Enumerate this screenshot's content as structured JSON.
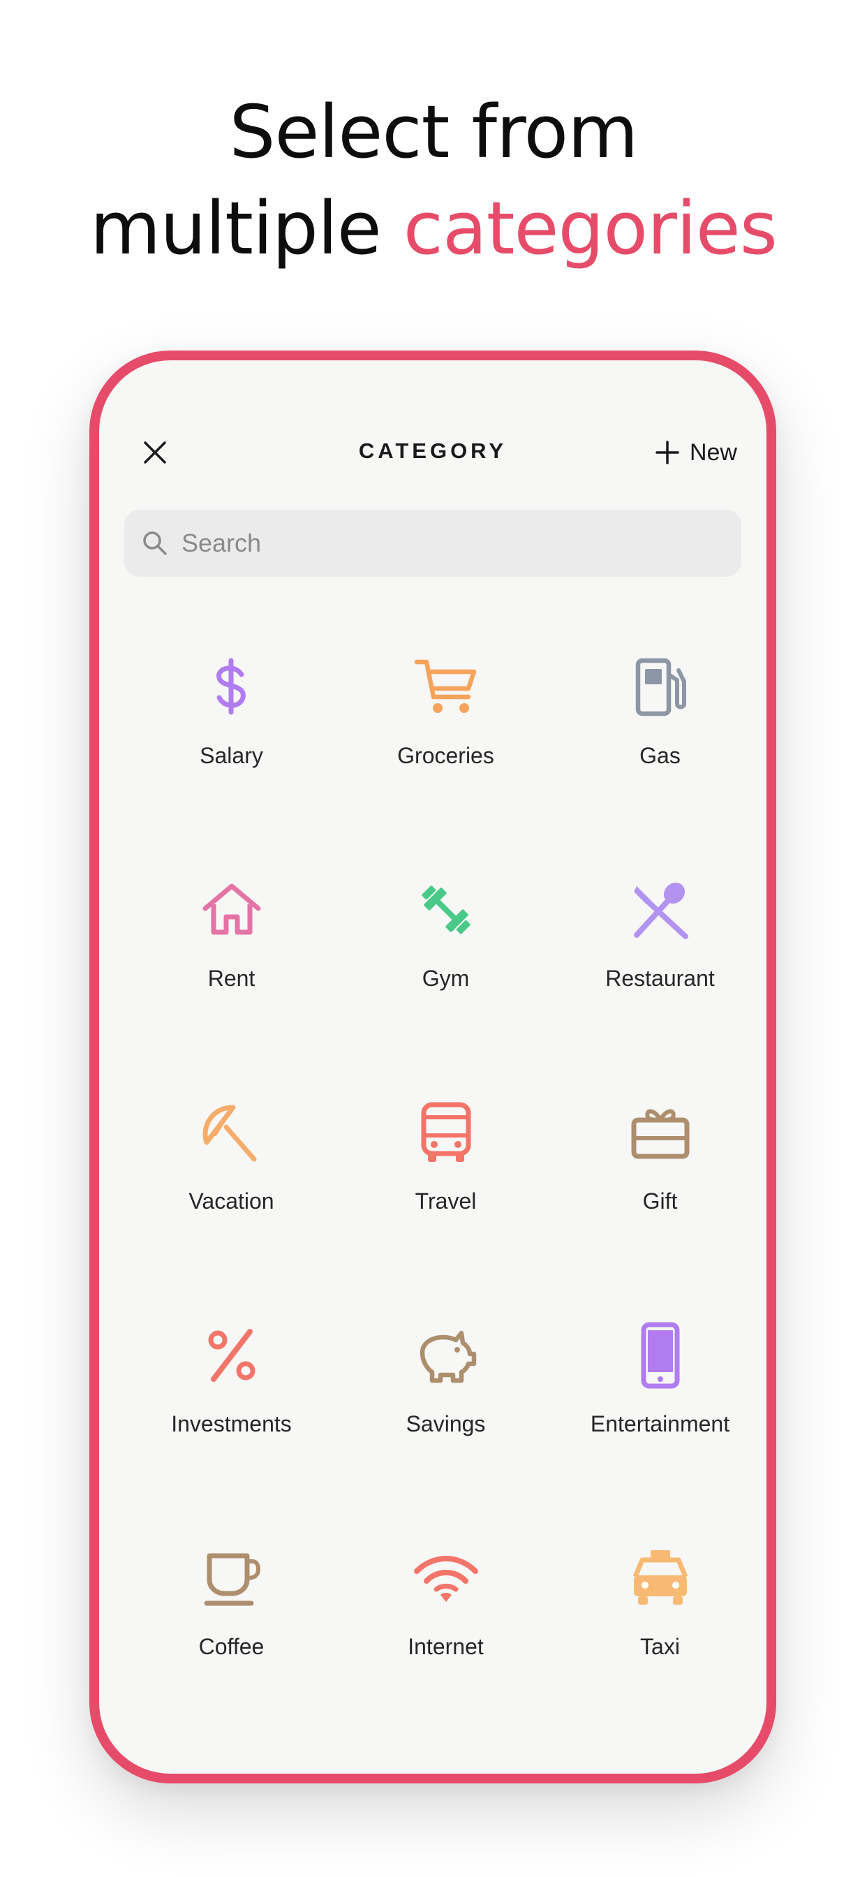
{
  "headline": {
    "line1": "Select from",
    "line2_plain": "multiple",
    "line2_accent": "categories"
  },
  "header": {
    "title": "CATEGORY",
    "new_label": "New"
  },
  "search": {
    "placeholder": "Search",
    "value": ""
  },
  "colors": {
    "accent": "#e64c69",
    "background": "#f7f7f6"
  },
  "categories": [
    {
      "label": "Salary",
      "icon": "dollar-icon",
      "color": "#b07cf0"
    },
    {
      "label": "Groceries",
      "icon": "cart-icon",
      "color": "#f6a35b"
    },
    {
      "label": "Gas",
      "icon": "gas-pump-icon",
      "color": "#8c96a4"
    },
    {
      "label": "Rent",
      "icon": "house-icon",
      "color": "#e574a6"
    },
    {
      "label": "Gym",
      "icon": "dumbbell-icon",
      "color": "#49c987"
    },
    {
      "label": "Restaurant",
      "icon": "utensils-icon",
      "color": "#b393f2"
    },
    {
      "label": "Vacation",
      "icon": "umbrella-icon",
      "color": "#f6ac6a"
    },
    {
      "label": "Travel",
      "icon": "bus-icon",
      "color": "#f37468"
    },
    {
      "label": "Gift",
      "icon": "gift-icon",
      "color": "#ad8f6e"
    },
    {
      "label": "Investments",
      "icon": "percent-icon",
      "color": "#f27569"
    },
    {
      "label": "Savings",
      "icon": "piggy-bank-icon",
      "color": "#ad8f6e"
    },
    {
      "label": "Entertainment",
      "icon": "phone-icon",
      "color": "#b07cf0"
    },
    {
      "label": "Coffee",
      "icon": "coffee-icon",
      "color": "#ad8f6e"
    },
    {
      "label": "Internet",
      "icon": "wifi-icon",
      "color": "#f37468"
    },
    {
      "label": "Taxi",
      "icon": "taxi-icon",
      "color": "#f8ba73"
    }
  ]
}
